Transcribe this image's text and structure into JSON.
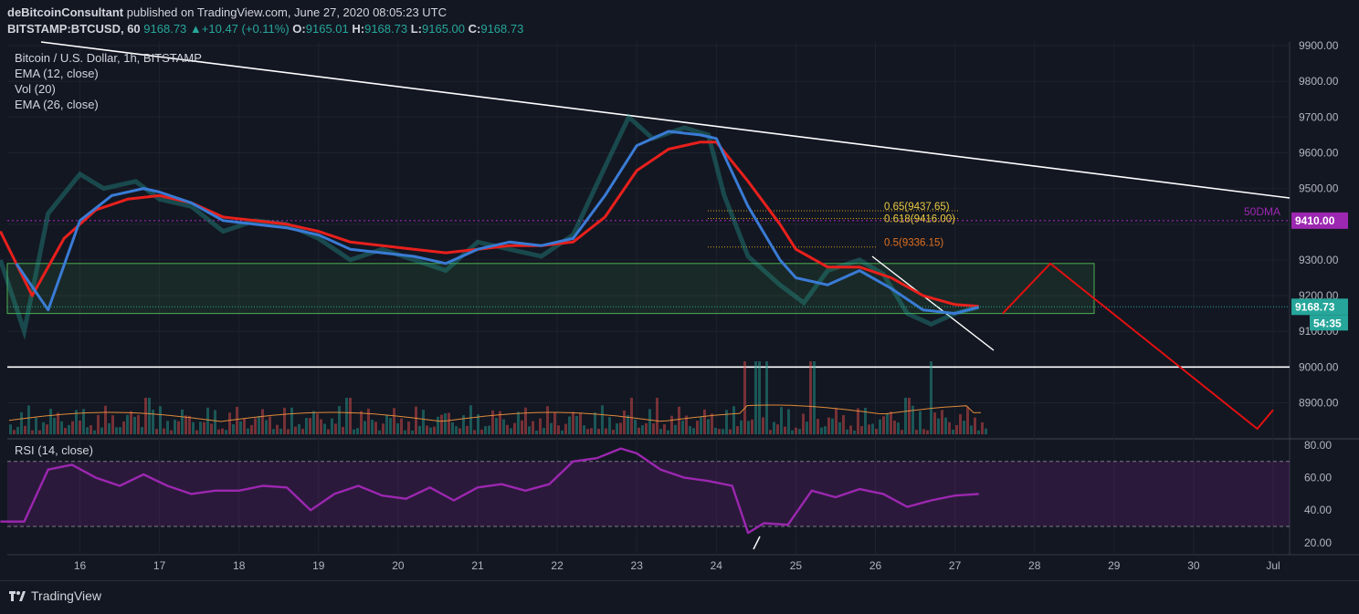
{
  "header": {
    "author": "deBitcoinConsultant",
    "published": "published on TradingView.com, June 27, 2020 08:05:23 UTC",
    "symbol": "BITSTAMP:BTCUSD, 60",
    "last": "9168.73",
    "change": "+10.47 (+0.11%)",
    "o_label": "O:",
    "o": "9165.01",
    "h_label": "H:",
    "h": "9168.73",
    "l_label": "L:",
    "l": "9165.00",
    "c_label": "C:",
    "c": "9168.73"
  },
  "legend": {
    "title": "Bitcoin / U.S. Dollar, 1h, BITSTAMP",
    "ema12": "EMA (12, close)",
    "vol": "Vol (20)",
    "ema26": "EMA (26, close)",
    "rsi": "RSI (14, close)"
  },
  "annotations": {
    "fib_065": "0.65(9437.65)",
    "fib_0618": "0.618(9416.00)",
    "fib_05": "0.5(9336.15)",
    "dma_label": "50DMA",
    "dma_value": "9410.00",
    "price_badge": "9168.73",
    "timer_badge": "54:35"
  },
  "colors": {
    "background": "#131722",
    "up": "#26a69a",
    "down": "#ef5350",
    "ema12": "#3a7bd5",
    "ema26": "#e8201c",
    "rsi": "#9c27b0",
    "zone": "#4caf50",
    "dma": "#9c27b0",
    "projection": "#e01010",
    "fib": "#d4a017"
  },
  "footer": {
    "brand": "TradingView"
  },
  "chart_data": [
    {
      "type": "line",
      "title": "Bitcoin / U.S. Dollar, 1h, BITSTAMP",
      "x_ticks": [
        "16",
        "17",
        "18",
        "19",
        "20",
        "21",
        "22",
        "23",
        "24",
        "25",
        "26",
        "27",
        "28",
        "29",
        "30",
        "Jul"
      ],
      "y_ticks": [
        "9900.00",
        "9800.00",
        "9700.00",
        "9600.00",
        "9500.00",
        "9400.00",
        "9300.00",
        "9200.00",
        "9100.00",
        "9000.00",
        "8900.00"
      ],
      "ylim": [
        8820,
        9940
      ],
      "series": [
        {
          "name": "EMA (12, close)",
          "x": [
            15.2,
            15.6,
            16.0,
            16.4,
            16.8,
            17.0,
            17.4,
            17.8,
            18.2,
            18.6,
            19.0,
            19.4,
            19.8,
            20.2,
            20.6,
            21.0,
            21.4,
            21.8,
            22.2,
            22.6,
            23.0,
            23.4,
            23.8,
            24.0,
            24.4,
            24.8,
            25.0,
            25.4,
            25.8,
            26.2,
            26.6,
            27.0,
            27.3
          ],
          "y": [
            9290,
            9160,
            9410,
            9480,
            9500,
            9490,
            9460,
            9410,
            9400,
            9390,
            9370,
            9330,
            9320,
            9310,
            9290,
            9330,
            9350,
            9340,
            9360,
            9480,
            9620,
            9660,
            9650,
            9640,
            9450,
            9300,
            9250,
            9230,
            9270,
            9220,
            9160,
            9150,
            9168
          ]
        },
        {
          "name": "EMA (26, close)",
          "x": [
            15.0,
            15.4,
            15.8,
            16.2,
            16.6,
            17.0,
            17.4,
            17.8,
            18.2,
            18.6,
            19.0,
            19.4,
            19.8,
            20.2,
            20.6,
            21.0,
            21.4,
            21.8,
            22.2,
            22.6,
            23.0,
            23.4,
            23.8,
            24.0,
            24.4,
            24.8,
            25.0,
            25.4,
            25.8,
            26.2,
            26.6,
            27.0,
            27.3
          ],
          "y": [
            9380,
            9200,
            9360,
            9440,
            9470,
            9480,
            9460,
            9420,
            9410,
            9400,
            9380,
            9350,
            9340,
            9330,
            9320,
            9330,
            9340,
            9340,
            9350,
            9420,
            9550,
            9610,
            9630,
            9630,
            9520,
            9400,
            9330,
            9280,
            9280,
            9250,
            9200,
            9175,
            9170
          ]
        },
        {
          "name": "BTCUSD close",
          "x": [
            15.0,
            15.3,
            15.6,
            16.0,
            16.3,
            16.7,
            17.0,
            17.4,
            17.8,
            18.2,
            18.6,
            19.0,
            19.4,
            19.8,
            20.2,
            20.6,
            21.0,
            21.4,
            21.8,
            22.2,
            22.6,
            22.9,
            23.2,
            23.6,
            23.9,
            24.1,
            24.4,
            24.8,
            25.1,
            25.4,
            25.8,
            26.1,
            26.4,
            26.7,
            27.0,
            27.3
          ],
          "y": [
            9300,
            9100,
            9430,
            9540,
            9500,
            9520,
            9470,
            9450,
            9380,
            9410,
            9400,
            9360,
            9300,
            9330,
            9300,
            9270,
            9350,
            9330,
            9310,
            9370,
            9560,
            9700,
            9640,
            9670,
            9650,
            9480,
            9310,
            9230,
            9180,
            9270,
            9300,
            9260,
            9150,
            9120,
            9150,
            9168
          ]
        }
      ],
      "levels": {
        "dma50": 9410,
        "fib_0.65": 9437.65,
        "fib_0.618": 9416.0,
        "fib_0.5": 9336.15,
        "support": 9000,
        "zone": [
          9150,
          9290
        ]
      },
      "projection": {
        "x": [
          27.6,
          28.2,
          30.8,
          31.0
        ],
        "y": [
          9150,
          9290,
          8820,
          8880
        ]
      }
    },
    {
      "type": "line",
      "title": "RSI (14, close)",
      "y_ticks": [
        "80.00",
        "60.00",
        "40.00",
        "20.00"
      ],
      "ylim": [
        15,
        85
      ],
      "series": [
        {
          "name": "RSI (14, close)",
          "x": [
            15.0,
            15.3,
            15.6,
            15.9,
            16.2,
            16.5,
            16.8,
            17.1,
            17.4,
            17.7,
            18.0,
            18.3,
            18.6,
            18.9,
            19.2,
            19.5,
            19.8,
            20.1,
            20.4,
            20.7,
            21.0,
            21.3,
            21.6,
            21.9,
            22.2,
            22.5,
            22.8,
            23.0,
            23.3,
            23.6,
            23.9,
            24.2,
            24.4,
            24.6,
            24.9,
            25.2,
            25.5,
            25.8,
            26.1,
            26.4,
            26.7,
            27.0,
            27.3
          ],
          "y": [
            33,
            33,
            65,
            68,
            60,
            55,
            62,
            55,
            50,
            52,
            52,
            55,
            54,
            40,
            50,
            55,
            49,
            47,
            54,
            46,
            54,
            56,
            52,
            56,
            70,
            72,
            78,
            75,
            65,
            60,
            58,
            55,
            26,
            32,
            31,
            52,
            48,
            53,
            50,
            42,
            46,
            49,
            50
          ]
        }
      ],
      "bands": [
        30,
        70
      ]
    }
  ]
}
